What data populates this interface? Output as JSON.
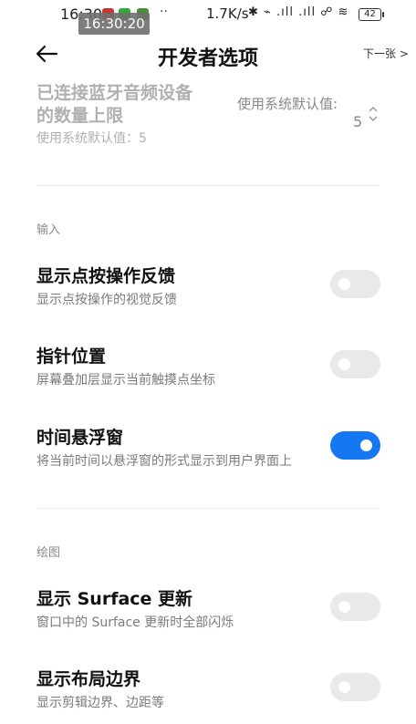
{
  "status_bar": {
    "time": "16:30",
    "dots": "··",
    "speed": "1.7K/s",
    "icons": "✱ ⌁ .ıll .ıll ☍ ≋",
    "battery": "42"
  },
  "clock_overlay": {
    "time": "16:30:20"
  },
  "header": {
    "title": "开发者选项",
    "next_label": "下一张 >"
  },
  "top_setting": {
    "title_line1": "已连接蓝牙音频设备",
    "title_line2": "的数量上限",
    "subtitle": "使用系统默认值：5",
    "value_label": "使用系统默认值:",
    "value_number": "5"
  },
  "sections": {
    "input": "输入",
    "drawing": "绘图"
  },
  "settings": [
    {
      "title": "显示点按操作反馈",
      "subtitle": "显示点按操作的视觉反馈",
      "enabled": false
    },
    {
      "title": "指针位置",
      "subtitle": "屏幕叠加层显示当前触摸点坐标",
      "enabled": false
    },
    {
      "title": "时间悬浮窗",
      "subtitle": "将当前时间以悬浮窗的形式显示到用户界面上",
      "enabled": true
    },
    {
      "title": "显示 Surface 更新",
      "subtitle": "窗口中的 Surface 更新时全部闪烁",
      "enabled": false
    },
    {
      "title": "显示布局边界",
      "subtitle": "显示剪辑边界、边距等",
      "enabled": false
    }
  ],
  "colors": {
    "accent": "#1677f2",
    "toggle_off": "#e9e9e9"
  }
}
